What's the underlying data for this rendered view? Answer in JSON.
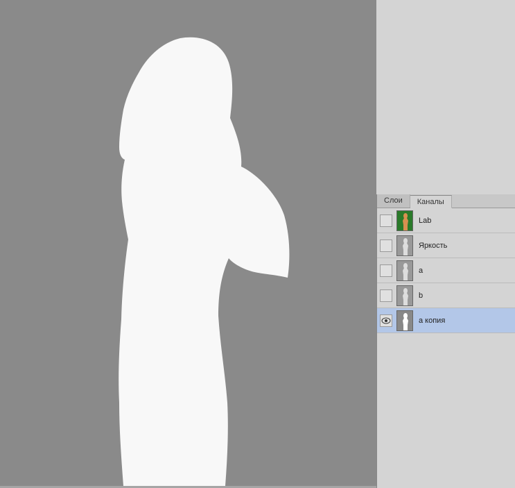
{
  "tabs": {
    "layers": "Слои",
    "channels": "Каналы"
  },
  "channels": [
    {
      "label": "Lab",
      "visible": false,
      "selected": false,
      "thumbType": "lab"
    },
    {
      "label": "Яркость",
      "visible": false,
      "selected": false,
      "thumbType": "gray"
    },
    {
      "label": "a",
      "visible": false,
      "selected": false,
      "thumbType": "gray"
    },
    {
      "label": "b",
      "visible": false,
      "selected": false,
      "thumbType": "gray"
    },
    {
      "label": "a копия",
      "visible": true,
      "selected": true,
      "thumbType": "silhouette"
    }
  ]
}
